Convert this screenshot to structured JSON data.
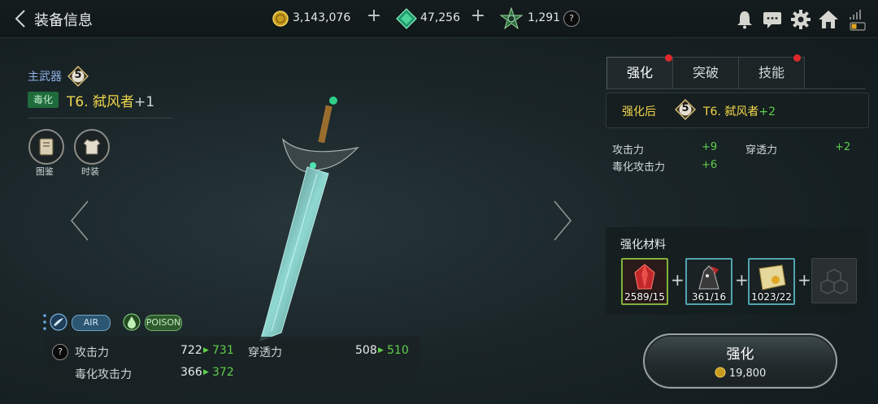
{
  "header": {
    "title": "装备信息",
    "currencies": [
      {
        "icon": "gold-coin-icon",
        "value": "3,143,076"
      },
      {
        "icon": "green-gem-icon",
        "value": "47,256"
      },
      {
        "icon": "star-crystal-icon",
        "value": "1,291"
      }
    ],
    "help_mark": "?"
  },
  "weapon": {
    "type_label": "主武器",
    "level": "5",
    "element_tag": "毒化",
    "name": "T6. 弑风者",
    "plus": "+1",
    "collection_label": "图鉴",
    "fashion_label": "时装"
  },
  "elements": {
    "air": "AIR",
    "poison": "POISON"
  },
  "stats": {
    "help_mark": "?",
    "attack_label": "攻击力",
    "attack_now": "722",
    "attack_next": "731",
    "pierce_label": "穿透力",
    "pierce_now": "508",
    "pierce_next": "510",
    "poison_label": "毒化攻击力",
    "poison_now": "366",
    "poison_next": "372"
  },
  "tabs": [
    {
      "label": "强化",
      "active": true,
      "dot": true
    },
    {
      "label": "突破",
      "active": false,
      "dot": false
    },
    {
      "label": "技能",
      "active": false,
      "dot": true
    }
  ],
  "after": {
    "label": "强化后",
    "level": "5",
    "name": "T6. 弑风者",
    "plus": "+2",
    "bonuses": [
      {
        "label": "攻击力",
        "value": "+9"
      },
      {
        "label": "穿透力",
        "value": "+2"
      },
      {
        "label": "毒化攻击力",
        "value": "+6"
      }
    ]
  },
  "materials": {
    "title": "强化材料",
    "items": [
      {
        "icon": "red-crystal-icon",
        "count": "2589/15",
        "border": "#7fb33a"
      },
      {
        "icon": "dark-beast-icon",
        "count": "361/16",
        "border": "#4fa4b0"
      },
      {
        "icon": "gold-scroll-icon",
        "count": "1023/22",
        "border": "#4fa4b0"
      }
    ]
  },
  "action": {
    "label": "强化",
    "cost": "19,800"
  }
}
